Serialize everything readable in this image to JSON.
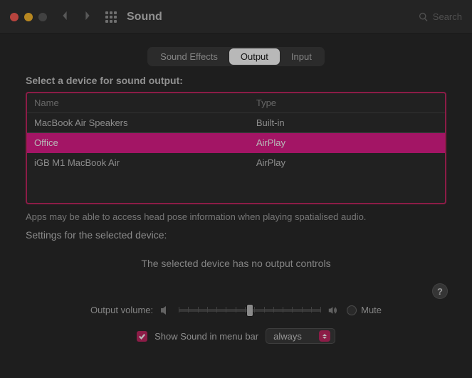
{
  "window": {
    "title": "Sound"
  },
  "search": {
    "placeholder": "Search"
  },
  "tabs": {
    "effects": "Sound Effects",
    "output": "Output",
    "input": "Input"
  },
  "output": {
    "select_label": "Select a device for sound output:",
    "columns": {
      "name": "Name",
      "type": "Type"
    },
    "devices": [
      {
        "name": "MacBook Air Speakers",
        "type": "Built-in"
      },
      {
        "name": "Office",
        "type": "AirPlay"
      },
      {
        "name": "iGB M1 MacBook Air",
        "type": "AirPlay"
      }
    ],
    "note": "Apps may be able to access head pose information when playing spatialised audio.",
    "settings_label": "Settings for the selected device:",
    "no_controls": "The selected device has no output controls"
  },
  "volume": {
    "label": "Output volume:",
    "mute_label": "Mute"
  },
  "menubar": {
    "show_label": "Show Sound in menu bar",
    "selected_option": "always"
  },
  "colors": {
    "highlight": "#e21e8c",
    "accent": "#c22863"
  }
}
